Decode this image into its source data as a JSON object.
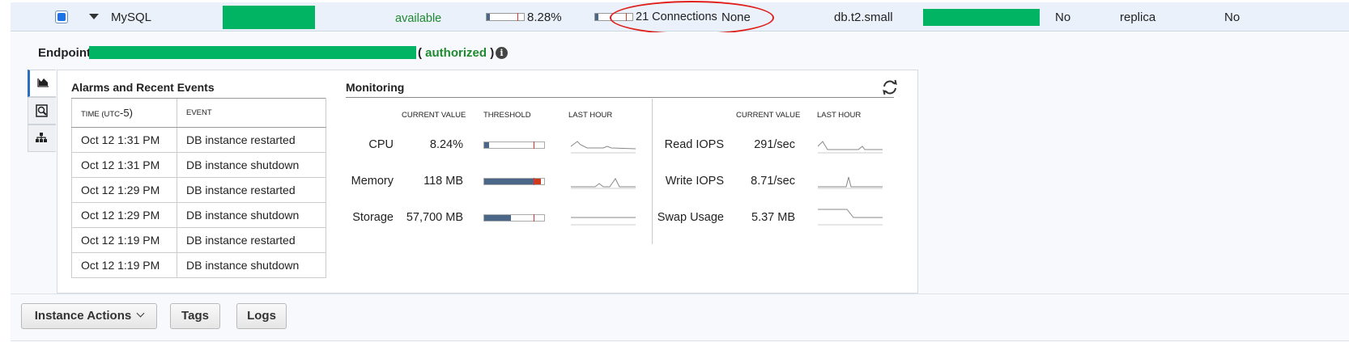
{
  "instance_row": {
    "engine": "MySQL",
    "status": "available",
    "cpu_percent": "8.28%",
    "cpu_fill": 0.0828,
    "connections": "21 Connections",
    "connections_fill": 0.05,
    "maintenance": "None",
    "instance_class": "db.t2.small",
    "multi_az": "No",
    "replication_role": "replica",
    "encrypted": "No",
    "accent_green": "#00b464"
  },
  "endpoint": {
    "label": "Endpoint:",
    "auth_open": "(",
    "auth_status": "authorized",
    "auth_close": ")",
    "info_glyph": "i"
  },
  "side_tabs": [
    {
      "icon": "area-chart-icon",
      "active": true
    },
    {
      "icon": "magnify-doc-icon",
      "active": false
    },
    {
      "icon": "hierarchy-icon",
      "active": false
    }
  ],
  "alarms": {
    "title": "Alarms and Recent Events",
    "col_time_small": "TIME (",
    "col_time_tz": "UTC",
    "col_time_offset": "-5)",
    "col_event": "EVENT",
    "rows": [
      {
        "time": "Oct 12 1:31 PM",
        "event": "DB instance restarted"
      },
      {
        "time": "Oct 12 1:31 PM",
        "event": "DB instance shutdown"
      },
      {
        "time": "Oct 12 1:29 PM",
        "event": "DB instance restarted"
      },
      {
        "time": "Oct 12 1:29 PM",
        "event": "DB instance shutdown"
      },
      {
        "time": "Oct 12 1:19 PM",
        "event": "DB instance restarted"
      },
      {
        "time": "Oct 12 1:19 PM",
        "event": "DB instance shutdown"
      }
    ]
  },
  "monitoring": {
    "title": "Monitoring",
    "hdr_current": "CURRENT VALUE",
    "hdr_threshold": "THRESHOLD",
    "hdr_last_hour": "LAST HOUR",
    "left_metrics": [
      {
        "label": "CPU",
        "value": "8.24%",
        "fill": 0.08,
        "red": 0
      },
      {
        "label": "Memory",
        "value": "118 MB",
        "fill": 0.85,
        "red": 0.13
      },
      {
        "label": "Storage",
        "value": "57,700 MB",
        "fill": 0.45,
        "red": 0
      }
    ],
    "right_metrics": [
      {
        "label": "Read IOPS",
        "value": "291/sec"
      },
      {
        "label": "Write IOPS",
        "value": "8.71/sec"
      },
      {
        "label": "Swap Usage",
        "value": "5.37 MB"
      }
    ]
  },
  "buttons": {
    "instance_actions": "Instance Actions",
    "tags": "Tags",
    "logs": "Logs"
  },
  "annotation_color": "#e0201c"
}
